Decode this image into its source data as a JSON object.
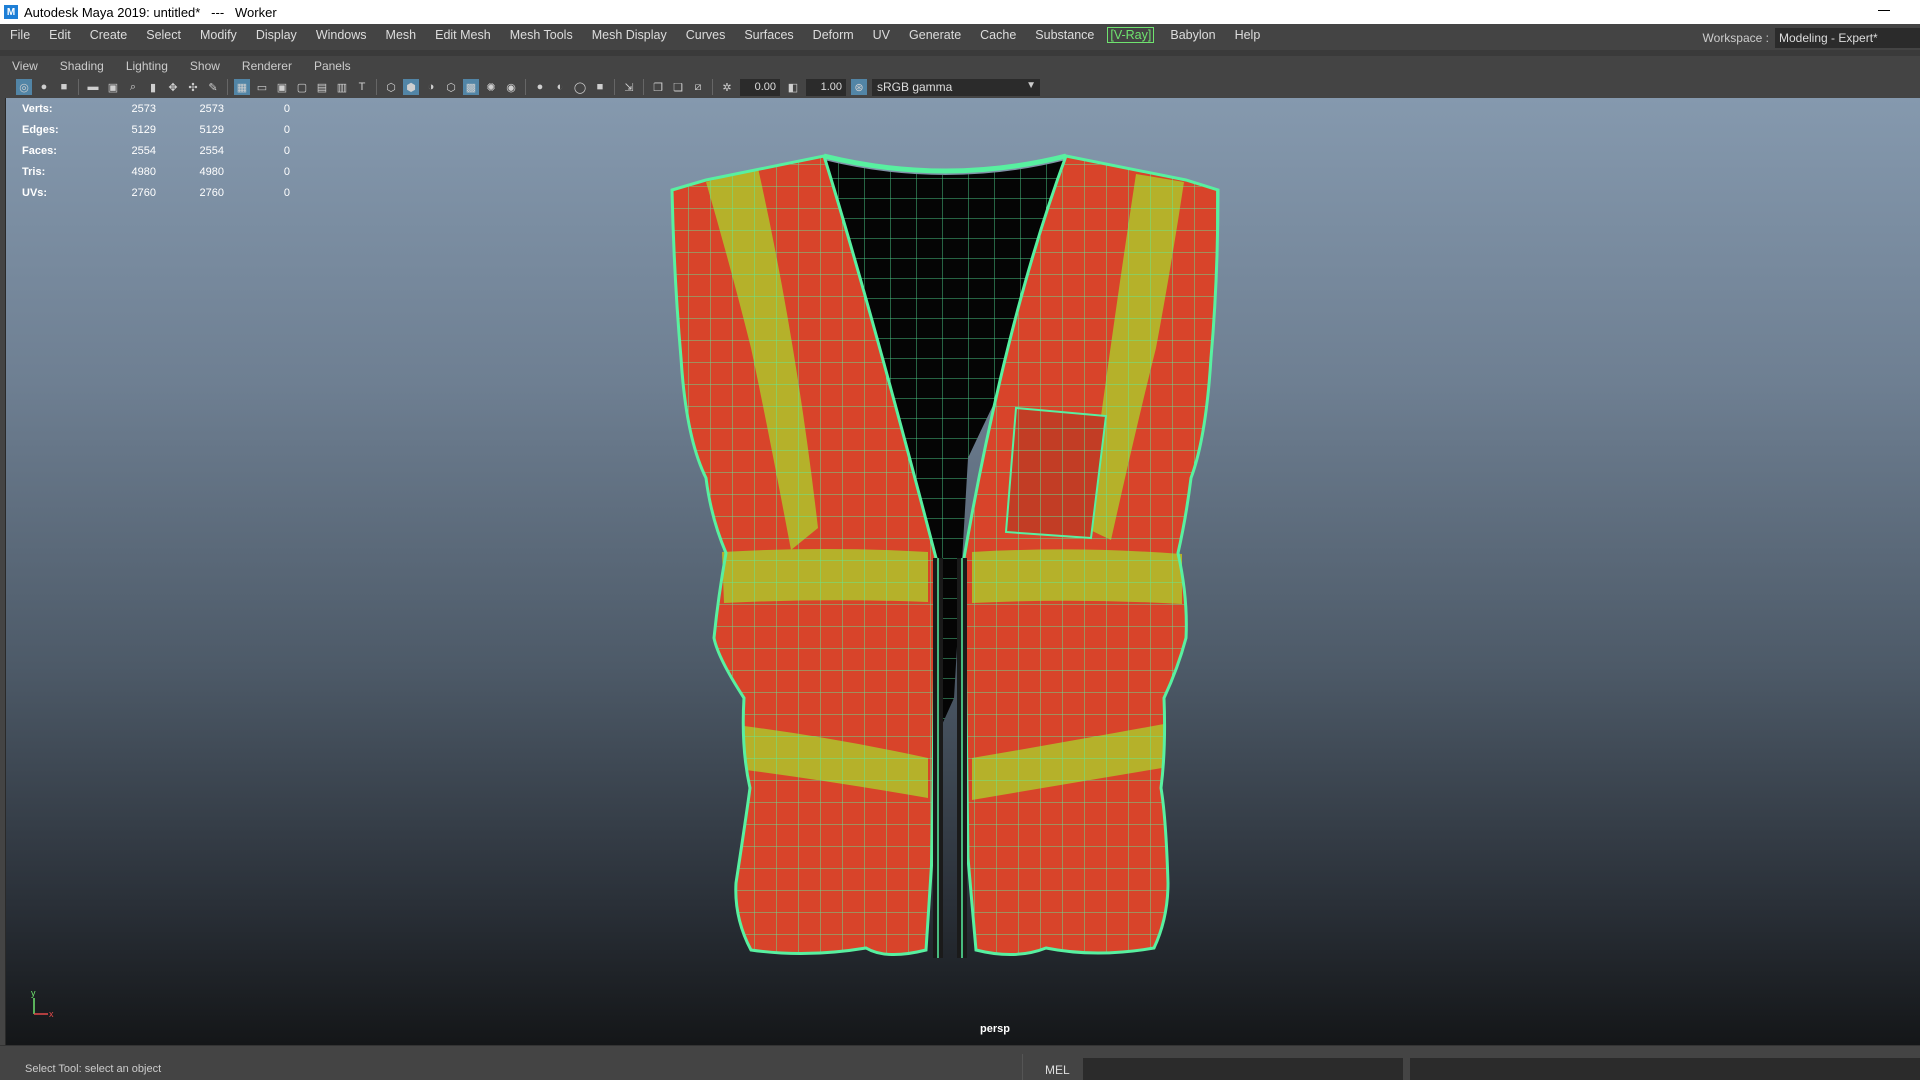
{
  "titlebar": {
    "title": "Autodesk Maya 2019: untitled*   ---   Worker"
  },
  "menubar": {
    "items": [
      "File",
      "Edit",
      "Create",
      "Select",
      "Modify",
      "Display",
      "Windows",
      "Mesh",
      "Edit Mesh",
      "Mesh Tools",
      "Mesh Display",
      "Curves",
      "Surfaces",
      "Deform",
      "UV",
      "Generate",
      "Cache",
      "Substance",
      "[V-Ray]",
      "Babylon",
      "Help"
    ]
  },
  "workspace": {
    "label": "Workspace :",
    "value": "Modeling - Expert*"
  },
  "panel_menu": {
    "items": [
      "View",
      "Shading",
      "Lighting",
      "Show",
      "Renderer",
      "Panels"
    ]
  },
  "toolbar": {
    "exposure": "0.00",
    "gamma": "1.00",
    "color_space": "sRGB gamma"
  },
  "hud": {
    "rows": [
      {
        "label": "Verts:",
        "v1": "2573",
        "v2": "2573",
        "v3": "0"
      },
      {
        "label": "Edges:",
        "v1": "5129",
        "v2": "5129",
        "v3": "0"
      },
      {
        "label": "Faces:",
        "v1": "2554",
        "v2": "2554",
        "v3": "0"
      },
      {
        "label": "Tris:",
        "v1": "4980",
        "v2": "4980",
        "v3": "0"
      },
      {
        "label": "UVs:",
        "v1": "2760",
        "v2": "2760",
        "v3": "0"
      }
    ]
  },
  "viewport": {
    "camera": "persp",
    "axis_y": "y",
    "axis_x": "x"
  },
  "colors": {
    "vest": "#d8442a",
    "reflective": "#b5b12a",
    "wire": "#58f0a0",
    "lining": "#050505"
  },
  "status": {
    "help_text": "Select Tool: select an object",
    "script_lang": "MEL"
  }
}
